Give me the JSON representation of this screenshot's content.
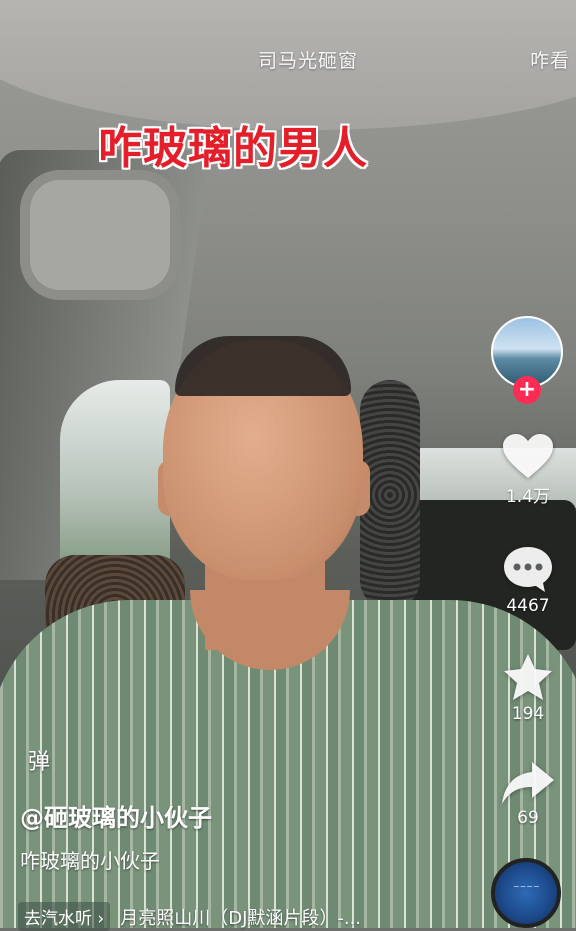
{
  "top_tabs": {
    "left": "司马光砸窗",
    "right": "咋看"
  },
  "caption": "咋玻璃的男人",
  "rail": {
    "follow_symbol": "+",
    "like_count": "1.4万",
    "comment_count": "4467",
    "favorite_count": "194",
    "share_count": "69"
  },
  "overlay": {
    "danmaku_label": "弹",
    "author": "@砸玻璃的小伙子",
    "description": "咋玻璃的小伙子",
    "music_chip": "去汽水听 ›",
    "music_title": "月亮照山川（DJ默涵片段）-..."
  },
  "colors": {
    "caption_red": "#e51f2a",
    "follow_pink": "#fe2c55"
  },
  "icons": [
    "heart-icon",
    "comment-icon",
    "star-icon",
    "share-icon",
    "music-disc-icon"
  ]
}
